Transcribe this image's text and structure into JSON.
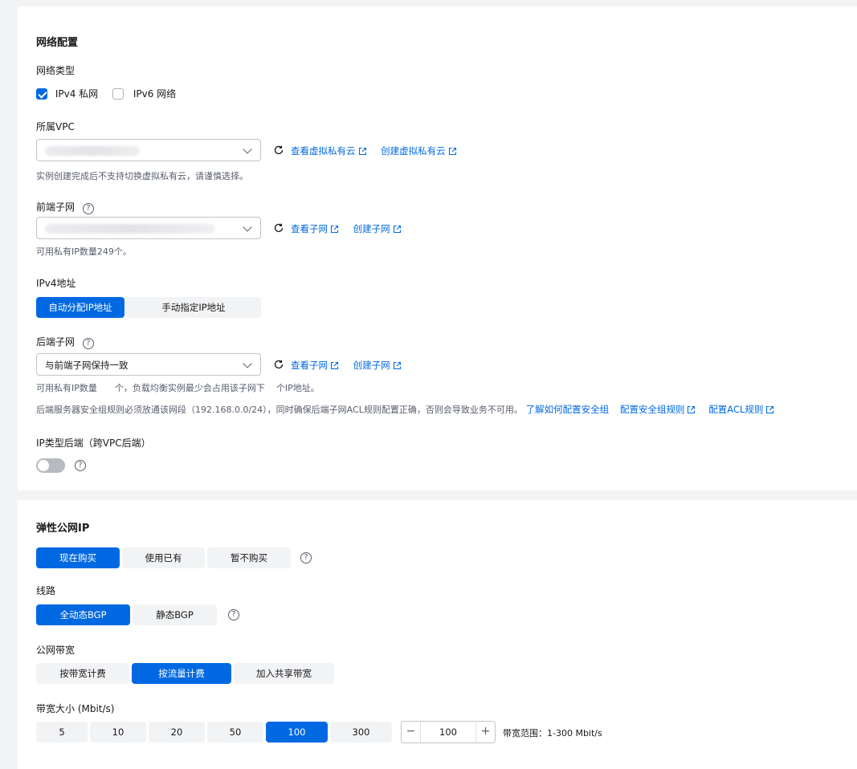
{
  "network": {
    "title": "网络配置",
    "network_type": {
      "label": "网络类型",
      "options": [
        {
          "label": "IPv4 私网",
          "checked": true
        },
        {
          "label": "IPv6 网络",
          "checked": false
        }
      ]
    },
    "vpc": {
      "label": "所属VPC",
      "value": "",
      "links": [
        "查看虚拟私有云",
        "创建虚拟私有云"
      ],
      "hint": "实例创建完成后不支持切换虚拟私有云，请谨慎选择。"
    },
    "frontend_subnet": {
      "label": "前端子网",
      "value": "",
      "links": [
        "查看子网",
        "创建子网"
      ],
      "hint": "可用私有IP数量249个。"
    },
    "ipv4": {
      "label": "IPv4地址",
      "options": [
        "自动分配IP地址",
        "手动指定IP地址"
      ],
      "selected": "自动分配IP地址"
    },
    "backend_subnet": {
      "label": "后端子网",
      "value": "与前端子网保持一致",
      "links": [
        "查看子网",
        "创建子网"
      ],
      "hint_part1": "可用私有IP数量",
      "hint_part2": "个，负载均衡实例最少会占用该子网下",
      "hint_part3": "个IP地址。",
      "security_notice": "后端服务器安全组规则必须放通该网段（192.168.0.0/24），同时确保后端子网ACL规则配置正确，否则会导致业务不可用。",
      "security_links": [
        "了解如何配置安全组",
        "配置安全组规则",
        "配置ACL规则"
      ]
    },
    "ip_backend": {
      "label": "IP类型后端（跨VPC后端）",
      "enabled": false
    }
  },
  "eip": {
    "title": "弹性公网IP",
    "purchase_options": [
      "现在购买",
      "使用已有",
      "暂不购买"
    ],
    "purchase_selected": "现在购买",
    "line": {
      "label": "线路",
      "options": [
        "全动态BGP",
        "静态BGP"
      ],
      "selected": "全动态BGP"
    },
    "bandwidth_type": {
      "label": "公网带宽",
      "options": [
        "按带宽计费",
        "按流量计费",
        "加入共享带宽"
      ],
      "selected": "按流量计费"
    },
    "bandwidth_size": {
      "label": "带宽大小 (Mbit/s)",
      "options": [
        "5",
        "10",
        "20",
        "50",
        "100",
        "300"
      ],
      "selected": "100",
      "value": "100",
      "minus": "−",
      "plus": "+",
      "range_text": "带宽范围：1-300 Mbit/s"
    }
  },
  "icons": {
    "help": "?",
    "refresh": "refresh-icon",
    "external": "external-link-icon"
  },
  "colors": {
    "primary": "#0069e2",
    "segment_bg": "#f2f3f5",
    "page_bg": "#f2f3f5"
  }
}
